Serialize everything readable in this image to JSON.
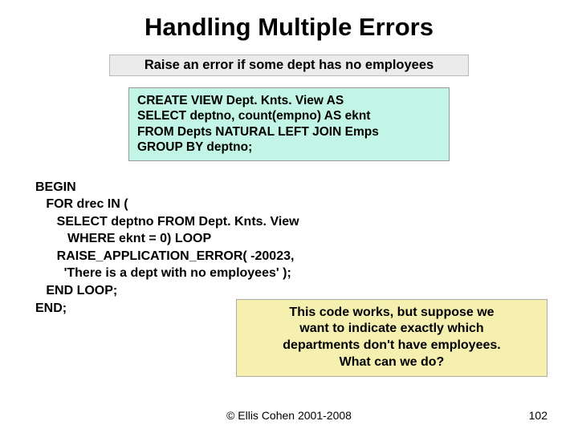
{
  "title": "Handling Multiple Errors",
  "subtitle": "Raise an error if some dept has no employees",
  "sql_view": {
    "line1": "CREATE VIEW Dept. Knts. View AS",
    "line2": "SELECT deptno, count(empno) AS eknt",
    "line3": "FROM Depts NATURAL LEFT JOIN Emps",
    "line4": "GROUP BY deptno;"
  },
  "plsql": {
    "l1": "BEGIN",
    "l2": "   FOR drec IN (",
    "l3": "      SELECT deptno FROM Dept. Knts. View",
    "l4": "         WHERE eknt = 0) LOOP",
    "l5": "      RAISE_APPLICATION_ERROR( -20023,",
    "l6": "        'There is a dept with no employees' );",
    "l7": "   END LOOP;",
    "l8": "END;"
  },
  "note": {
    "l1": "This code works, but suppose we",
    "l2": "want to indicate exactly which",
    "l3": "departments don't have employees.",
    "l4": "What can we do?"
  },
  "footer": {
    "copyright": "© Ellis Cohen 2001-2008",
    "page": "102"
  }
}
